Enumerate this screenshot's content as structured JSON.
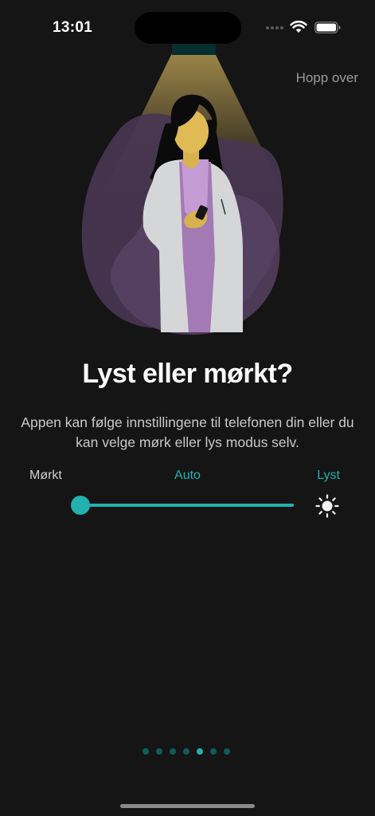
{
  "status_bar": {
    "time": "13:01"
  },
  "skip_label": "Hopp over",
  "title": "Lyst eller mørkt?",
  "description": "Appen kan følge innstillingene til telefonen din eller du kan velge mørk eller lys modus selv.",
  "theme_slider": {
    "labels": {
      "dark": "Mørkt",
      "auto": "Auto",
      "light": "Lyst"
    },
    "selected": "Mørkt",
    "value": 0,
    "dark_icon": "moon-icon",
    "light_icon": "sun-icon"
  },
  "pagination": {
    "total": 7,
    "current": 5
  },
  "colors": {
    "background": "#151515",
    "accent": "#22b1ae",
    "inactive_dot": "#0e5c5c",
    "text_secondary": "#c9c9c9"
  }
}
